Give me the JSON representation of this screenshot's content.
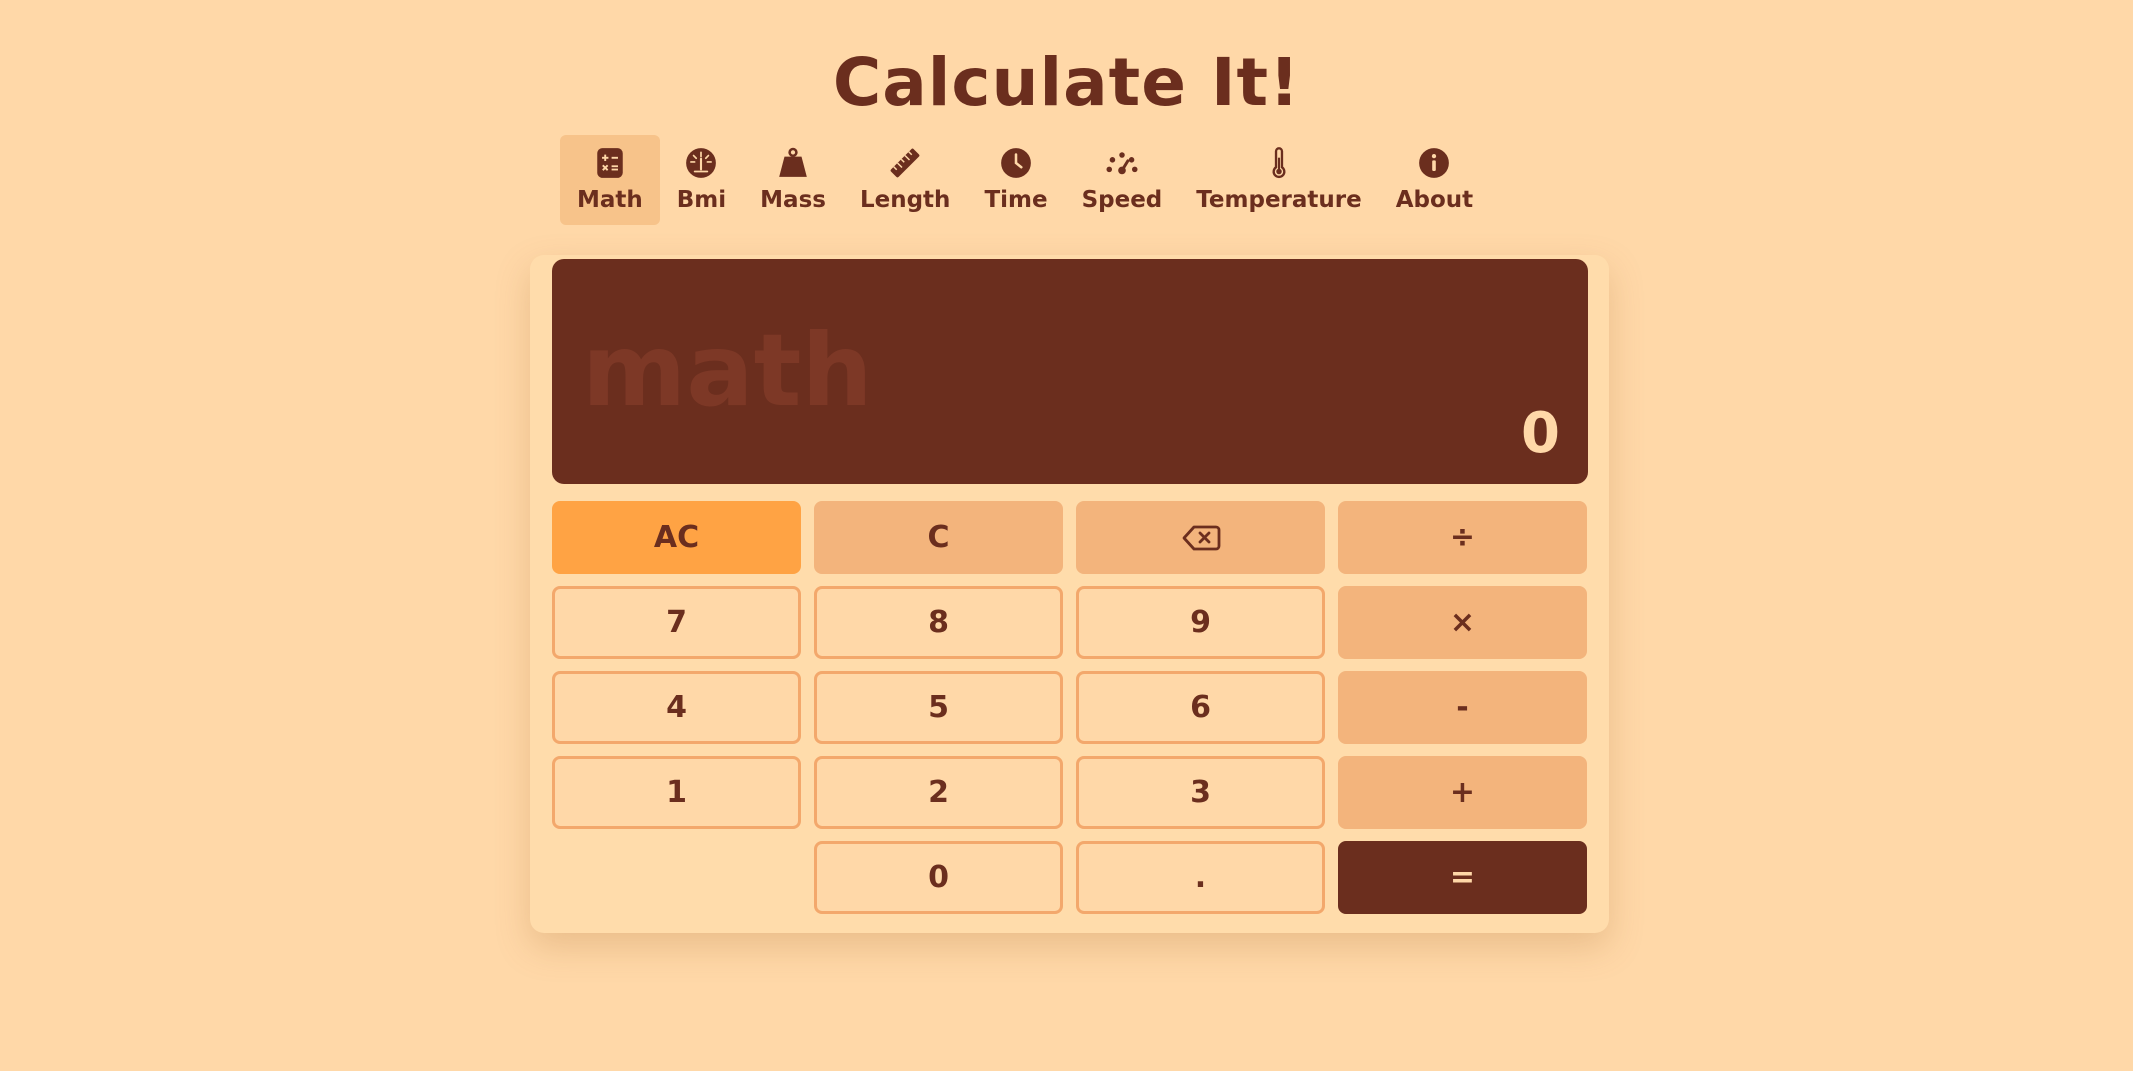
{
  "app": {
    "title": "Calculate It!"
  },
  "nav": {
    "active": "Math",
    "items": [
      {
        "label": "Math",
        "icon": "calculator-icon"
      },
      {
        "label": "Bmi",
        "icon": "gauge-icon"
      },
      {
        "label": "Mass",
        "icon": "weight-icon"
      },
      {
        "label": "Length",
        "icon": "ruler-icon"
      },
      {
        "label": "Time",
        "icon": "clock-icon"
      },
      {
        "label": "Speed",
        "icon": "speedometer-icon"
      },
      {
        "label": "Temperature",
        "icon": "thermometer-icon"
      },
      {
        "label": "About",
        "icon": "info-icon"
      }
    ]
  },
  "display": {
    "mode": "math",
    "value": "0"
  },
  "keypad": {
    "ac": "AC",
    "c": "C",
    "backspace_icon": "backspace-icon",
    "divide": "÷",
    "seven": "7",
    "eight": "8",
    "nine": "9",
    "multiply": "×",
    "four": "4",
    "five": "5",
    "six": "6",
    "subtract": "-",
    "one": "1",
    "two": "2",
    "three": "3",
    "add": "+",
    "zero": "0",
    "decimal": ".",
    "equals": "="
  },
  "colors": {
    "background": "#FFD8A8",
    "primary": "#6B2E1E",
    "accent": "#FFA344",
    "operator": "#F3B47C",
    "active_tab": "#F7C38A",
    "key_border": "#F3A86C"
  }
}
